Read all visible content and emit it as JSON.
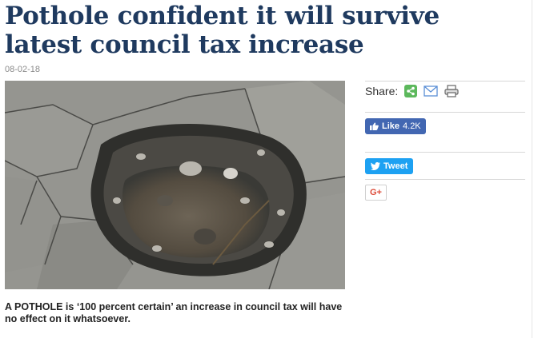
{
  "article": {
    "headline": "Pothole confident it will survive latest council tax increase",
    "date": "08-02-18",
    "standfirst": "A POTHOLE is ‘100 percent certain’ an increase in council tax will have no effect on it whatsoever.",
    "image_icon": "pothole-photo"
  },
  "share": {
    "label": "Share:",
    "icons": [
      "share-icon",
      "mail-icon",
      "print-icon"
    ],
    "facebook": {
      "label": "Like",
      "count": "4.2K"
    },
    "twitter": {
      "label": "Tweet"
    },
    "gplus": {
      "label": "G+"
    }
  },
  "colors": {
    "headline": "#1f3a5f",
    "facebook": "#4267b2",
    "twitter": "#1da1f2",
    "gplus": "#dd4b39",
    "share_green": "#5cb85c"
  }
}
